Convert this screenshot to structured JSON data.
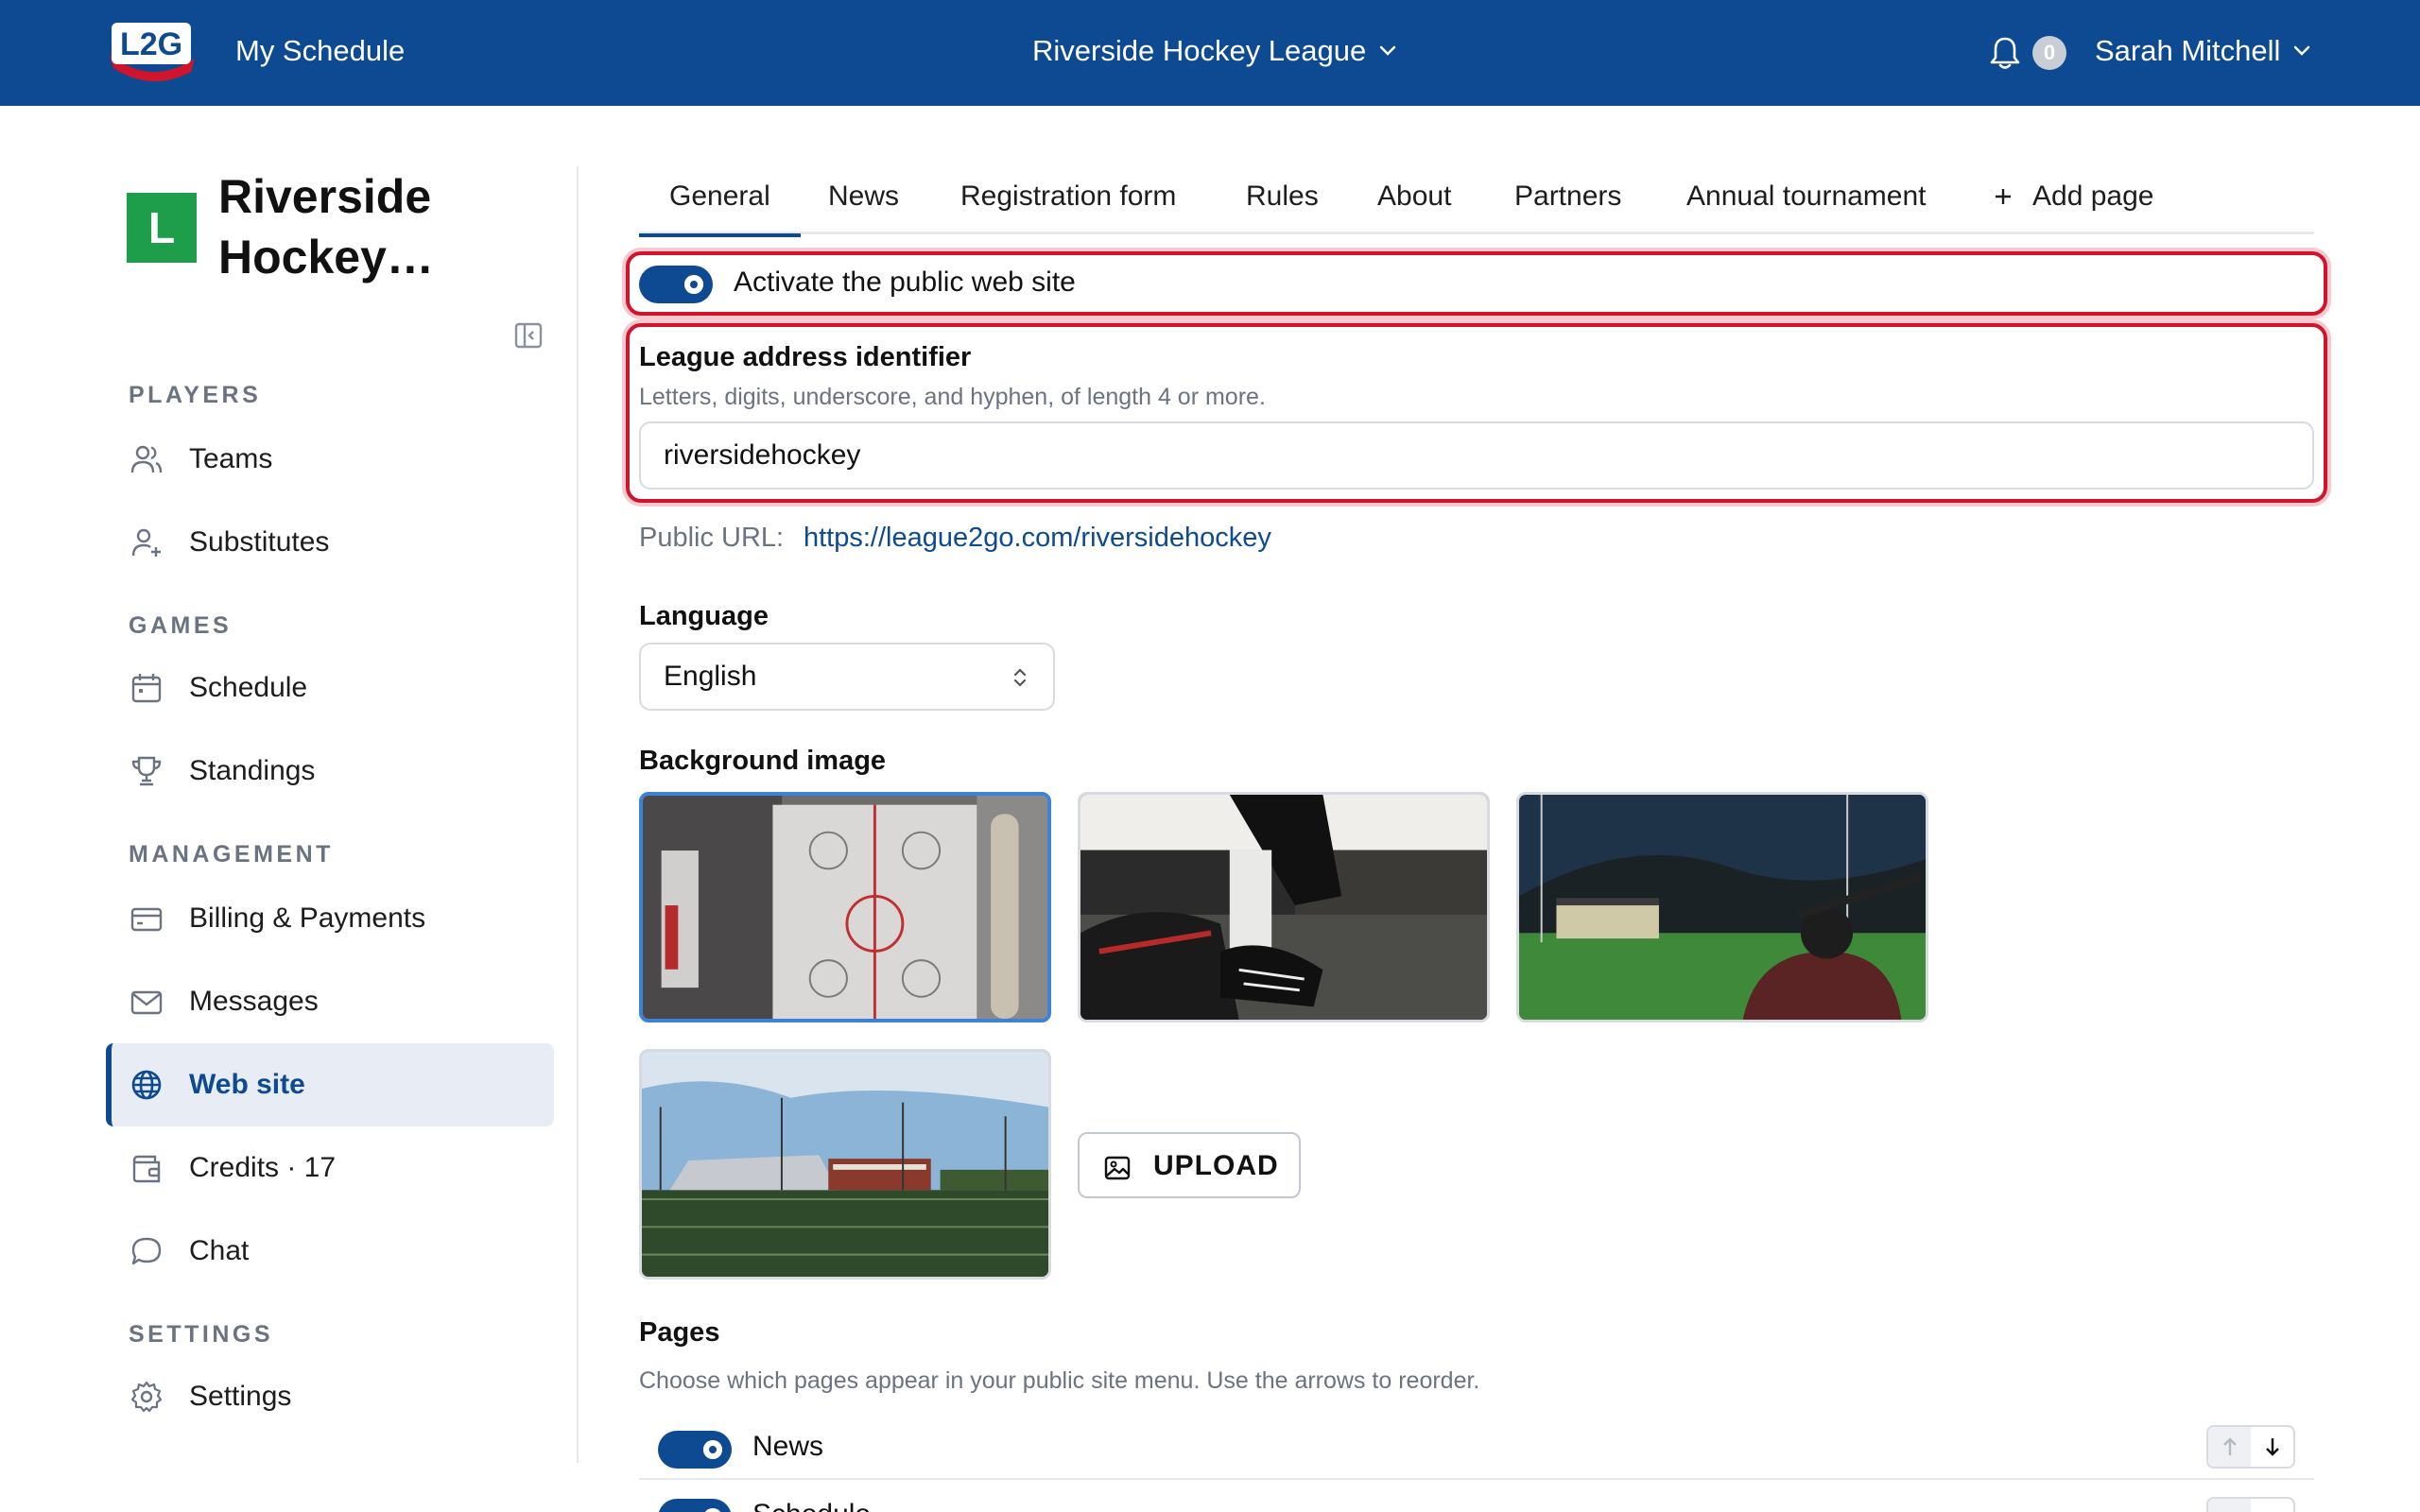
{
  "header": {
    "logo_text": "L2G",
    "my_schedule": "My Schedule",
    "league_switcher": "Riverside Hockey League",
    "notification_count": "0",
    "user_name": "Sarah Mitchell"
  },
  "sidebar": {
    "avatar_letter": "L",
    "league_name": "Riverside Hockey…",
    "sections": {
      "players": "PLAYERS",
      "games": "GAMES",
      "management": "MANAGEMENT",
      "settings": "SETTINGS"
    },
    "items": {
      "teams": "Teams",
      "substitutes": "Substitutes",
      "schedule": "Schedule",
      "standings": "Standings",
      "billing": "Billing & Payments",
      "messages": "Messages",
      "website": "Web site",
      "credits": "Credits · 17",
      "chat": "Chat",
      "settings": "Settings"
    },
    "active_item": "website"
  },
  "tabs": [
    "General",
    "News",
    "Registration form",
    "Rules",
    "About",
    "Partners",
    "Annual tournament"
  ],
  "tab_add_page": "Add page",
  "active_tab": "General",
  "general": {
    "activate_label": "Activate the public web site",
    "activate_on": true,
    "identifier_title": "League address identifier",
    "identifier_help": "Letters, digits, underscore, and hyphen, of length 4 or more.",
    "identifier_value": "riversidehockey",
    "public_url_label": "Public URL:",
    "public_url": "https://league2go.com/riversidehockey",
    "language_title": "Language",
    "language_value": "English",
    "background_title": "Background image",
    "upload_label": "UPLOAD",
    "pages_title": "Pages",
    "pages_help": "Choose which pages appear in your public site menu. Use the arrows to reorder.",
    "pages": [
      {
        "label": "News",
        "enabled": true
      },
      {
        "label": "Schedule",
        "enabled": true
      }
    ]
  },
  "colors": {
    "brand": "#0d4a91",
    "highlight": "#d0142c",
    "avatar": "#1e9e4a",
    "selected_thumb": "#3d82d6"
  }
}
